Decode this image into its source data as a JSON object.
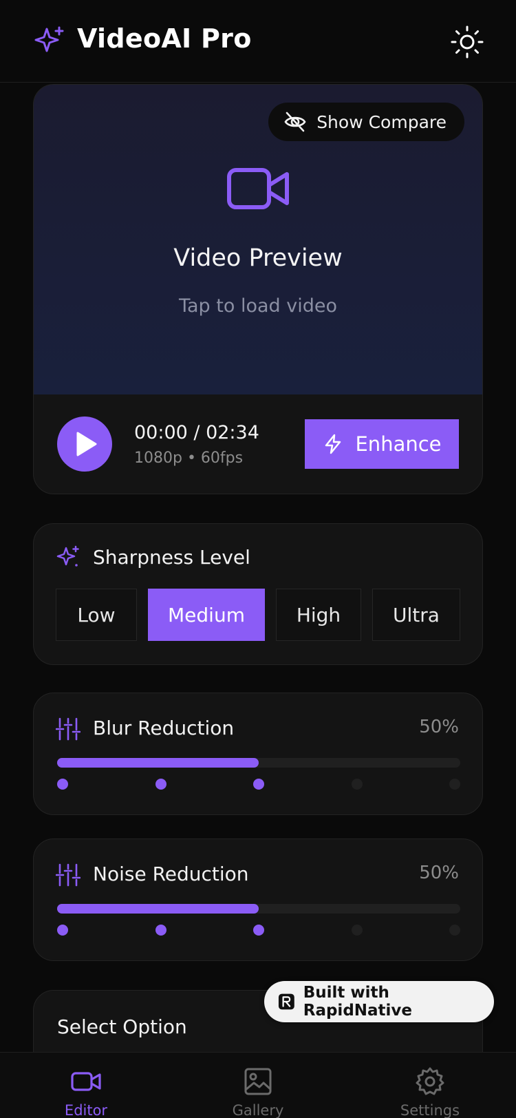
{
  "header": {
    "title": "VideoAI Pro",
    "brand_icon": "sparkles-icon",
    "theme_icon": "sun-icon"
  },
  "preview": {
    "compare_label": "Show Compare",
    "compare_icon": "eye-off-icon",
    "title": "Video Preview",
    "subtitle": "Tap to load video",
    "time": "00:00 / 02:34",
    "meta": "1080p • 60fps",
    "enhance_label": "Enhance"
  },
  "sharpness": {
    "title": "Sharpness Level",
    "options": [
      "Low",
      "Medium",
      "High",
      "Ultra"
    ],
    "selected": "Medium"
  },
  "blur": {
    "title": "Blur Reduction",
    "value_text": "50%",
    "value": 0.5,
    "steps": 5,
    "active_steps": 3
  },
  "noise": {
    "title": "Noise Reduction",
    "value_text": "50%",
    "value": 0.5,
    "steps": 5,
    "active_steps": 3
  },
  "select": {
    "label": "Select Option"
  },
  "badge": {
    "label": "Built with RapidNative"
  },
  "tabs": [
    {
      "label": "Editor",
      "icon": "video-icon",
      "active": true
    },
    {
      "label": "Gallery",
      "icon": "image-icon",
      "active": false
    },
    {
      "label": "Settings",
      "icon": "gear-icon",
      "active": false
    }
  ],
  "colors": {
    "accent": "#8b5cf6",
    "background": "#0a0a0a",
    "card": "#141414",
    "muted_text": "#8d8d8d"
  }
}
